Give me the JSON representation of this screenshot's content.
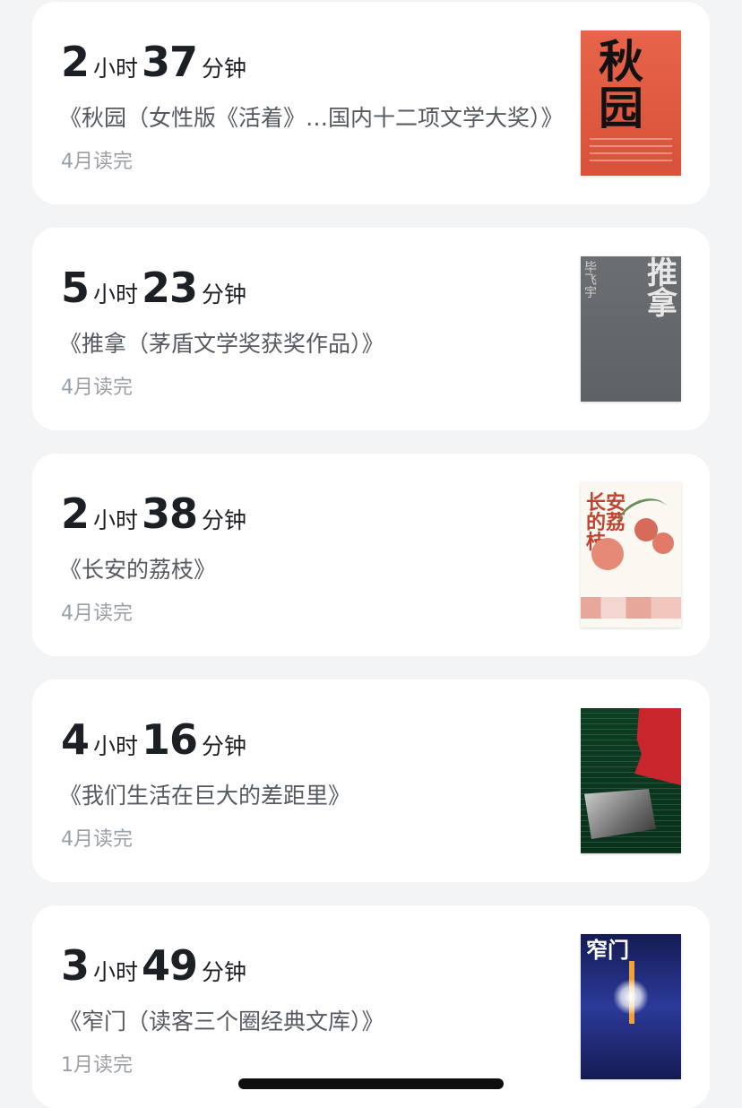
{
  "records": [
    {
      "hours": "2",
      "hour_unit": "小时",
      "minutes": "37",
      "minute_unit": "分钟",
      "title": "《秋园（女性版《活着》…国内十二项文学大奖）》",
      "finished": "4月读完",
      "cover_text": [
        "秋",
        "园"
      ]
    },
    {
      "hours": "5",
      "hour_unit": "小时",
      "minutes": "23",
      "minute_unit": "分钟",
      "title": "《推拿（茅盾文学奖获奖作品）》",
      "finished": "4月读完",
      "cover_text": [
        "推拿",
        "毕飞宇"
      ]
    },
    {
      "hours": "2",
      "hour_unit": "小时",
      "minutes": "38",
      "minute_unit": "分钟",
      "title": "《长安的荔枝》",
      "finished": "4月读完",
      "cover_text": [
        "长安的荔枝"
      ]
    },
    {
      "hours": "4",
      "hour_unit": "小时",
      "minutes": "16",
      "minute_unit": "分钟",
      "title": "《我们生活在巨大的差距里》",
      "finished": "4月读完",
      "cover_text": []
    },
    {
      "hours": "3",
      "hour_unit": "小时",
      "minutes": "49",
      "minute_unit": "分钟",
      "title": "《窄门（读客三个圈经典文库）》",
      "finished": "1月读完",
      "cover_text": [
        "窄门"
      ]
    }
  ]
}
